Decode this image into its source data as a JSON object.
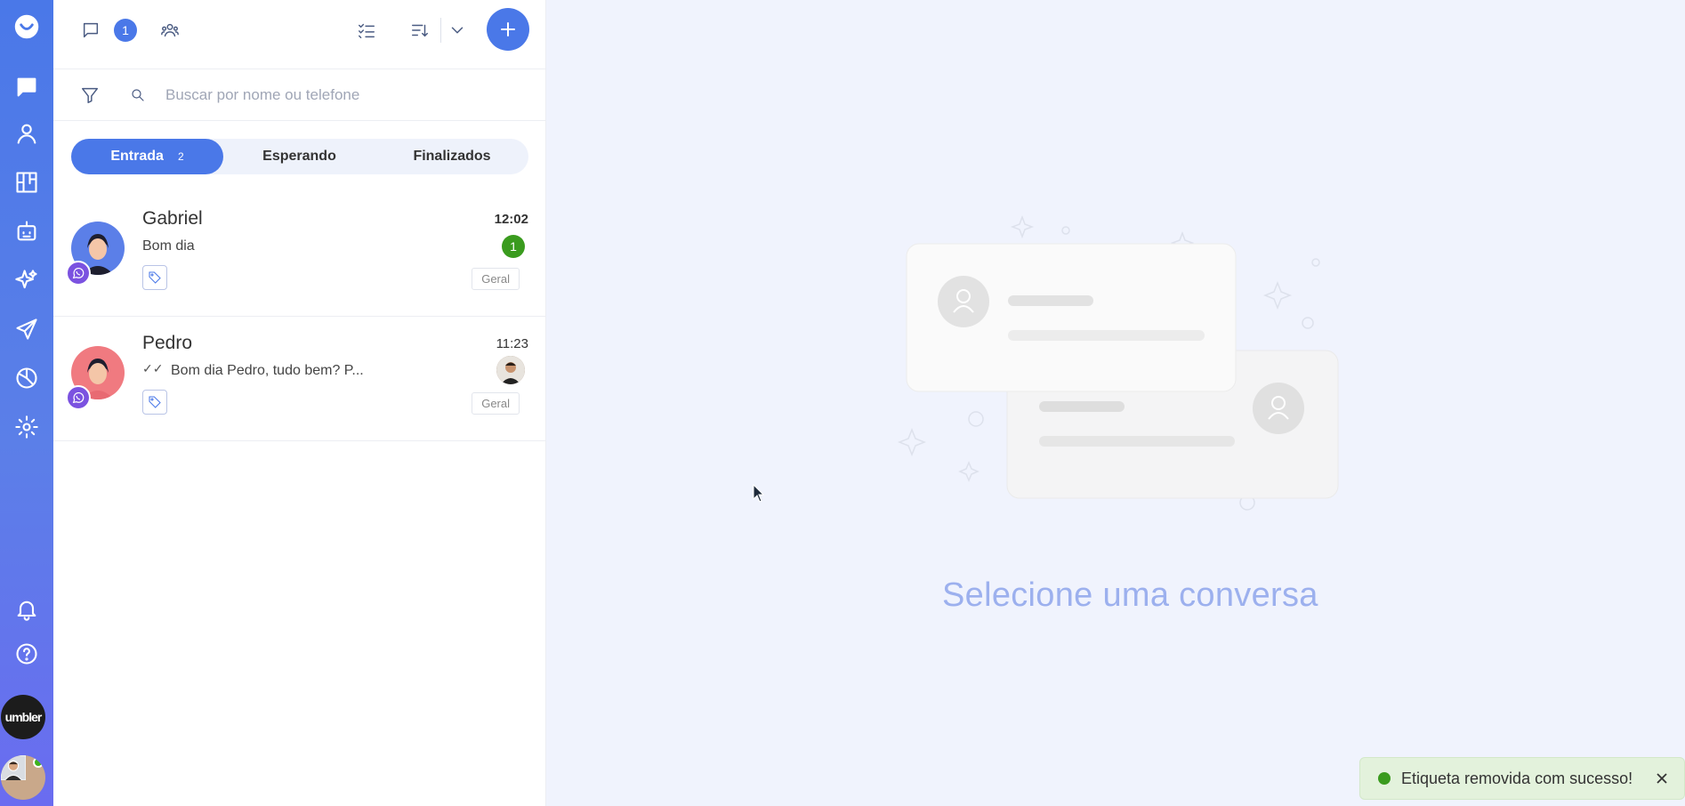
{
  "sidebar": {
    "icons": [
      "chat-icon",
      "contacts-icon",
      "kanban-icon",
      "bot-icon",
      "ai-sparkle-icon",
      "send-icon",
      "reports-icon",
      "settings-icon",
      "bell-icon",
      "help-icon"
    ],
    "brand_label": "umbler"
  },
  "header": {
    "chat_count": "1"
  },
  "search": {
    "placeholder": "Buscar por nome ou telefone"
  },
  "tabs": [
    {
      "label": "Entrada",
      "count": "2",
      "active": true
    },
    {
      "label": "Esperando",
      "active": false
    },
    {
      "label": "Finalizados",
      "active": false
    }
  ],
  "conversations": [
    {
      "name": "Gabriel",
      "time": "12:02",
      "message": "Bom dia",
      "unread": "1",
      "department": "Geral",
      "avatar_color": "#5b7fe8"
    },
    {
      "name": "Pedro",
      "time": "11:23",
      "message": "Bom dia Pedro, tudo bem? P...",
      "ticks": "✓✓",
      "department": "Geral",
      "avatar_color": "#f07a80"
    }
  ],
  "empty_state": {
    "title": "Selecione uma conversa"
  },
  "toast": {
    "message": "Etiqueta removida com sucesso!",
    "color": "#3a9b1e"
  },
  "colors": {
    "accent": "#4a78e8",
    "whatsapp_badge": "#7b52e0"
  }
}
